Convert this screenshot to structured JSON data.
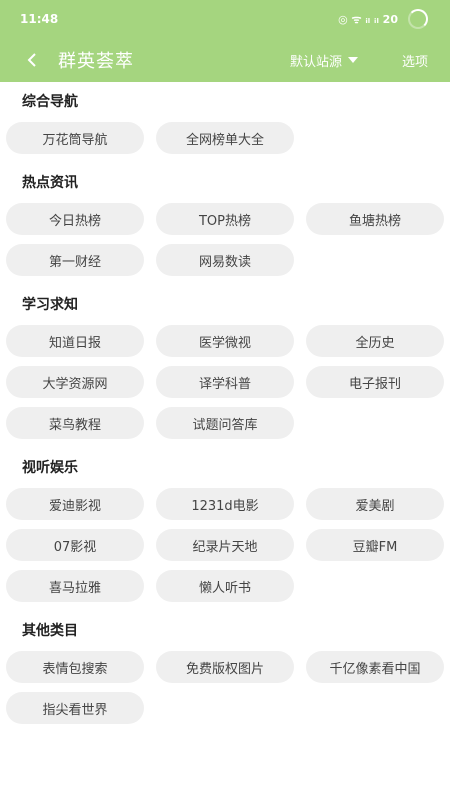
{
  "status_bar": {
    "time": "11:48",
    "indicators": "◎ ᯤ ᵢₗ ᵢₗ 20"
  },
  "app_bar": {
    "title": "群英荟萃",
    "station_label": "默认站源",
    "options_label": "选项"
  },
  "colors": {
    "header": "#a5d57f",
    "chip_bg": "#efefef"
  },
  "sections": [
    {
      "title": "综合导航",
      "items": [
        "万花筒导航",
        "全网榜单大全"
      ]
    },
    {
      "title": "热点资讯",
      "items": [
        "今日热榜",
        "TOP热榜",
        "鱼塘热榜",
        "第一财经",
        "网易数读"
      ]
    },
    {
      "title": "学习求知",
      "items": [
        "知道日报",
        "医学微视",
        "全历史",
        "大学资源网",
        "译学科普",
        "电子报刊",
        "菜鸟教程",
        "试题问答库"
      ]
    },
    {
      "title": "视听娱乐",
      "items": [
        "爱迪影视",
        "1231d电影",
        "爱美剧",
        "07影视",
        "纪录片天地",
        "豆瓣FM",
        "喜马拉雅",
        "懒人听书"
      ]
    },
    {
      "title": "其他类目",
      "items": [
        "表情包搜索",
        "免费版权图片",
        "千亿像素看中国",
        "指尖看世界"
      ]
    }
  ]
}
